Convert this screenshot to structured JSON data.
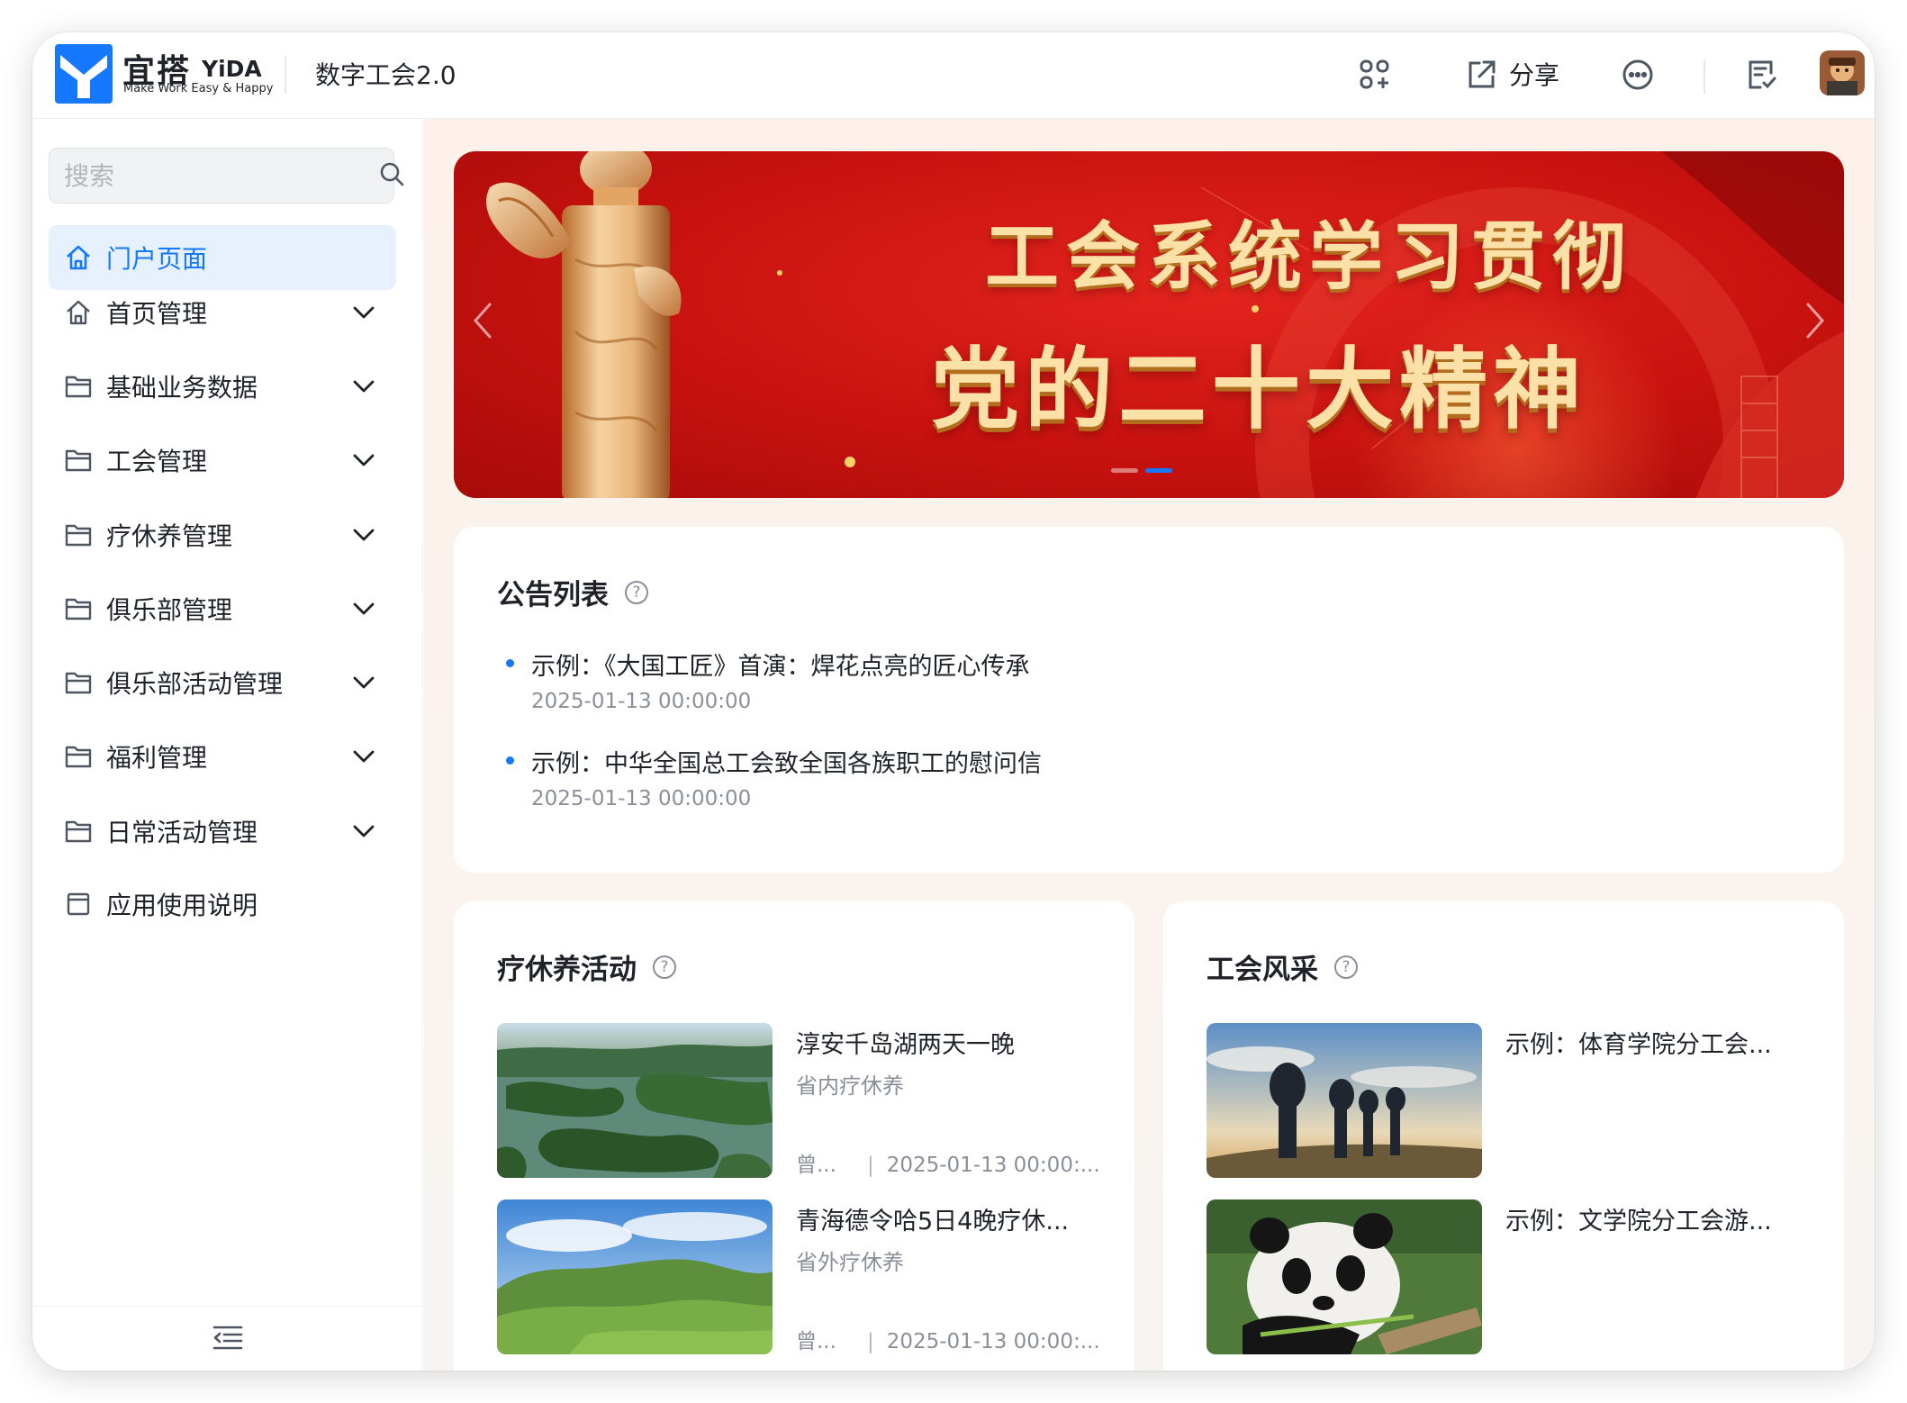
{
  "topbar": {
    "brand_cn": "宜搭",
    "brand_en": "YiDA",
    "slogan": "Make Work Easy & Happy",
    "app_title": "数字工会2.0",
    "share_label": "分享",
    "icons": [
      "apps-icon",
      "share-icon",
      "more-icon",
      "checklist-icon",
      "avatar"
    ]
  },
  "sidebar": {
    "search_placeholder": "搜索",
    "items": [
      {
        "label": "门户页面",
        "icon": "home-icon",
        "active": true
      },
      {
        "label": "首页管理",
        "icon": "home-icon",
        "expandable": true
      },
      {
        "label": "基础业务数据",
        "icon": "folder-icon",
        "expandable": true
      },
      {
        "label": "工会管理",
        "icon": "folder-icon",
        "expandable": true
      },
      {
        "label": "疗休养管理",
        "icon": "folder-icon",
        "expandable": true
      },
      {
        "label": "俱乐部管理",
        "icon": "folder-icon",
        "expandable": true
      },
      {
        "label": "俱乐部活动管理",
        "icon": "folder-icon",
        "expandable": true
      },
      {
        "label": "福利管理",
        "icon": "folder-icon",
        "expandable": true
      },
      {
        "label": "日常活动管理",
        "icon": "folder-icon",
        "expandable": true
      },
      {
        "label": "应用使用说明",
        "icon": "page-icon"
      }
    ]
  },
  "banner": {
    "title": "工会系统学习贯彻",
    "subtitle": "党的二十大精神",
    "slide_count": 2,
    "active_slide": 2
  },
  "notices": {
    "title": "公告列表",
    "items": [
      {
        "title": "示例：《大国工匠》首演：焊花点亮的匠心传承",
        "date": "2025-01-13 00:00:00"
      },
      {
        "title": "示例：中华全国总工会致全国各族职工的慰问信",
        "date": "2025-01-13 00:00:00"
      }
    ]
  },
  "recuperation": {
    "title": "疗休养活动",
    "items": [
      {
        "title": "淳安千岛湖两天一晚",
        "category": "省内疗休养",
        "author": "曾...",
        "date": "2025-01-13 00:00:..."
      },
      {
        "title": "青海德令哈5日4晚疗休...",
        "category": "省外疗休养",
        "author": "曾...",
        "date": "2025-01-13 00:00:..."
      }
    ]
  },
  "union_style": {
    "title": "工会风采",
    "items": [
      {
        "title": "示例：体育学院分工会..."
      },
      {
        "title": "示例：文学院分工会游..."
      }
    ]
  },
  "colors": {
    "accent": "#1677ff",
    "banner_red": "#c8120f",
    "gold": "#fbe0a8"
  }
}
